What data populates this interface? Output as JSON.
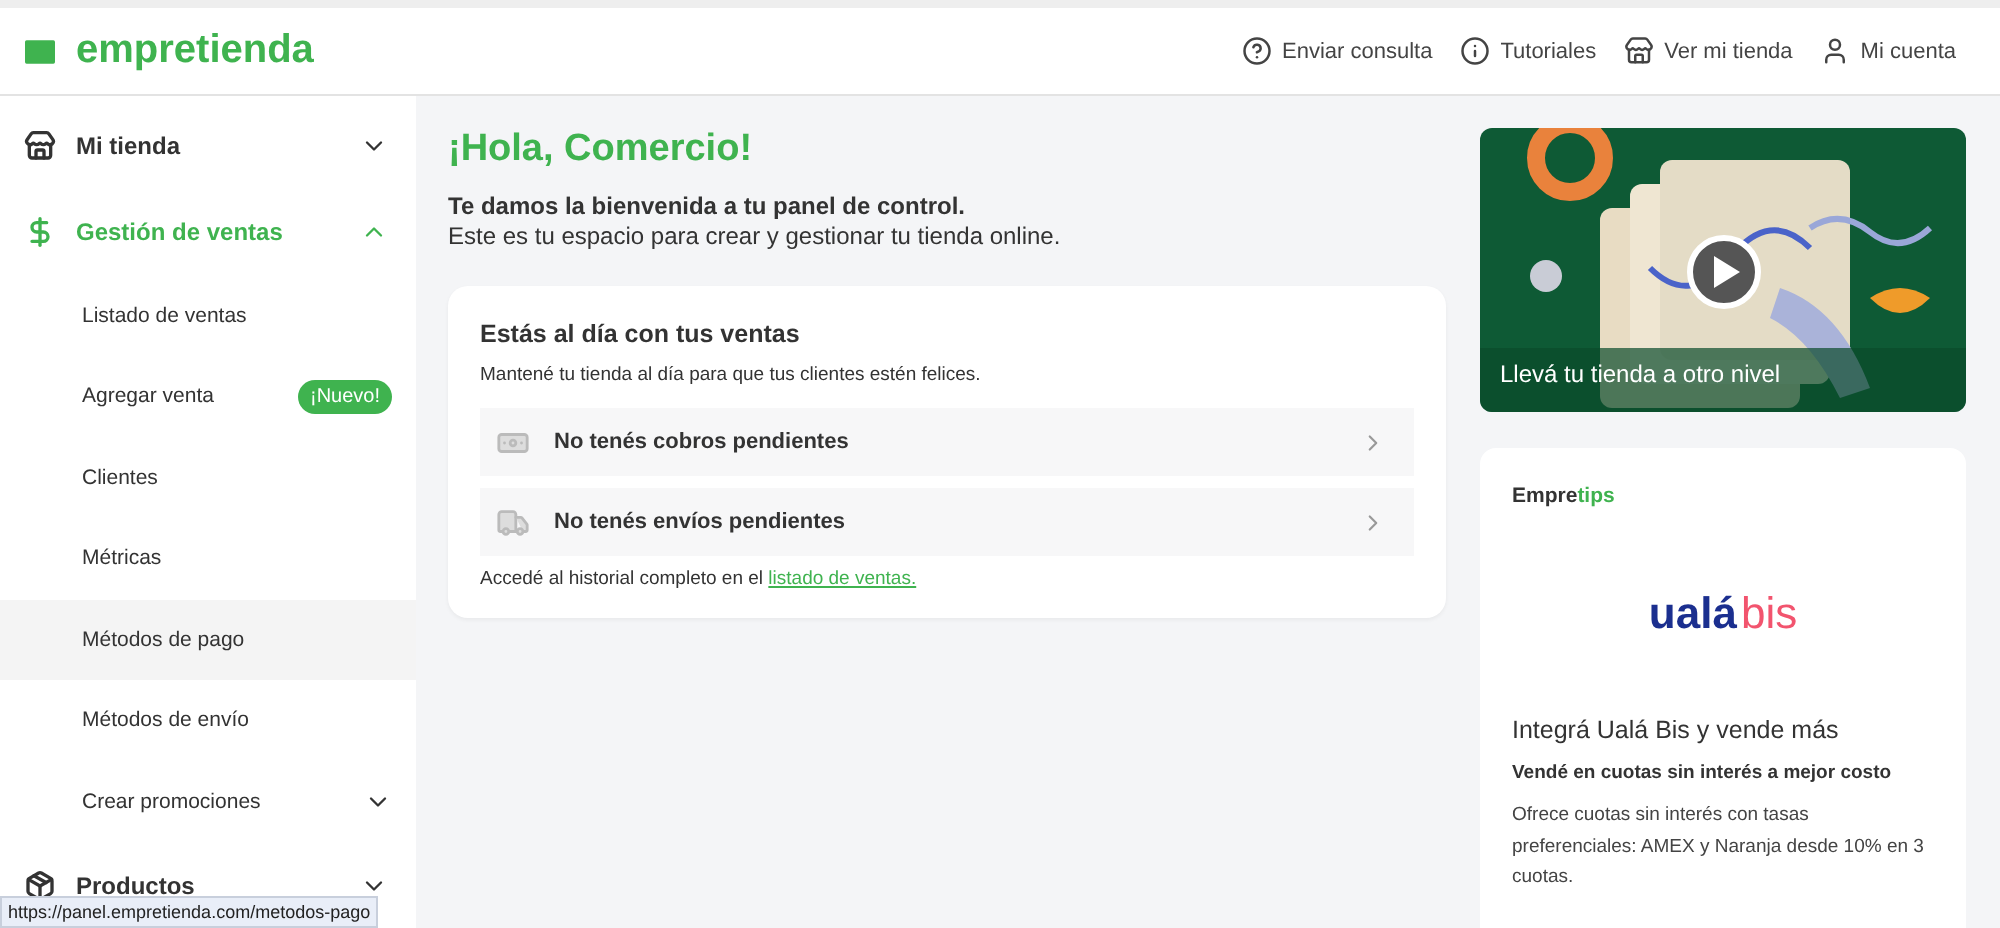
{
  "header": {
    "brand": "empretienda",
    "actions": [
      {
        "kind": "help",
        "label": "Enviar consulta"
      },
      {
        "kind": "info",
        "label": "Tutoriales"
      },
      {
        "kind": "store",
        "label": "Ver mi tienda"
      },
      {
        "kind": "user",
        "label": "Mi cuenta"
      }
    ]
  },
  "sidebar": {
    "items": [
      {
        "kind": "store",
        "label": "Mi tienda",
        "expanded": false,
        "active": false
      },
      {
        "kind": "dollar",
        "label": "Gestión de ventas",
        "expanded": true,
        "active": true,
        "children": [
          {
            "label": "Listado de ventas",
            "selected": false
          },
          {
            "label": "Agregar venta",
            "selected": false,
            "badge": "¡Nuevo!"
          },
          {
            "label": "Clientes",
            "selected": false
          },
          {
            "label": "Métricas",
            "selected": false
          },
          {
            "label": "Métodos de pago",
            "selected": true
          },
          {
            "label": "Métodos de envío",
            "selected": false
          },
          {
            "label": "Crear promociones",
            "selected": false,
            "expandable": true
          }
        ]
      },
      {
        "kind": "box",
        "label": "Productos",
        "expanded": false,
        "active": false
      }
    ]
  },
  "main": {
    "greeting": "¡Hola, Comercio!",
    "welcome": "Te damos la bienvenida a tu panel de control.",
    "subtitle": "Este es tu espacio para crear y gestionar tu tienda online.",
    "sales_card": {
      "title": "Estás al día con tus ventas",
      "description": "Mantené tu tienda al día para que tus clientes estén felices.",
      "rows": [
        {
          "kind": "money",
          "label": "No tenés cobros pendientes"
        },
        {
          "kind": "truck",
          "label": "No tenés envíos pendientes"
        }
      ],
      "footer": "Accedé al historial completo en el",
      "footer_link": "listado de ventas."
    }
  },
  "video": {
    "kind": "picture",
    "caption": "Llevá tu tienda a otro nivel"
  },
  "tips": {
    "title_start": "Empre",
    "title_end": "tips",
    "logo_start": "ualá",
    "logo_end": "bis",
    "heading": "Integrá Ualá Bis y vende más",
    "subheading": "Vendé en cuotas sin interés a mejor costo",
    "body": "Ofrece cuotas sin interés con tasas preferenciales: AMEX y Naranja desde 10% en 3 cuotas."
  },
  "status_bar": {
    "url": "https://panel.empretienda.com/metodos-pago"
  }
}
